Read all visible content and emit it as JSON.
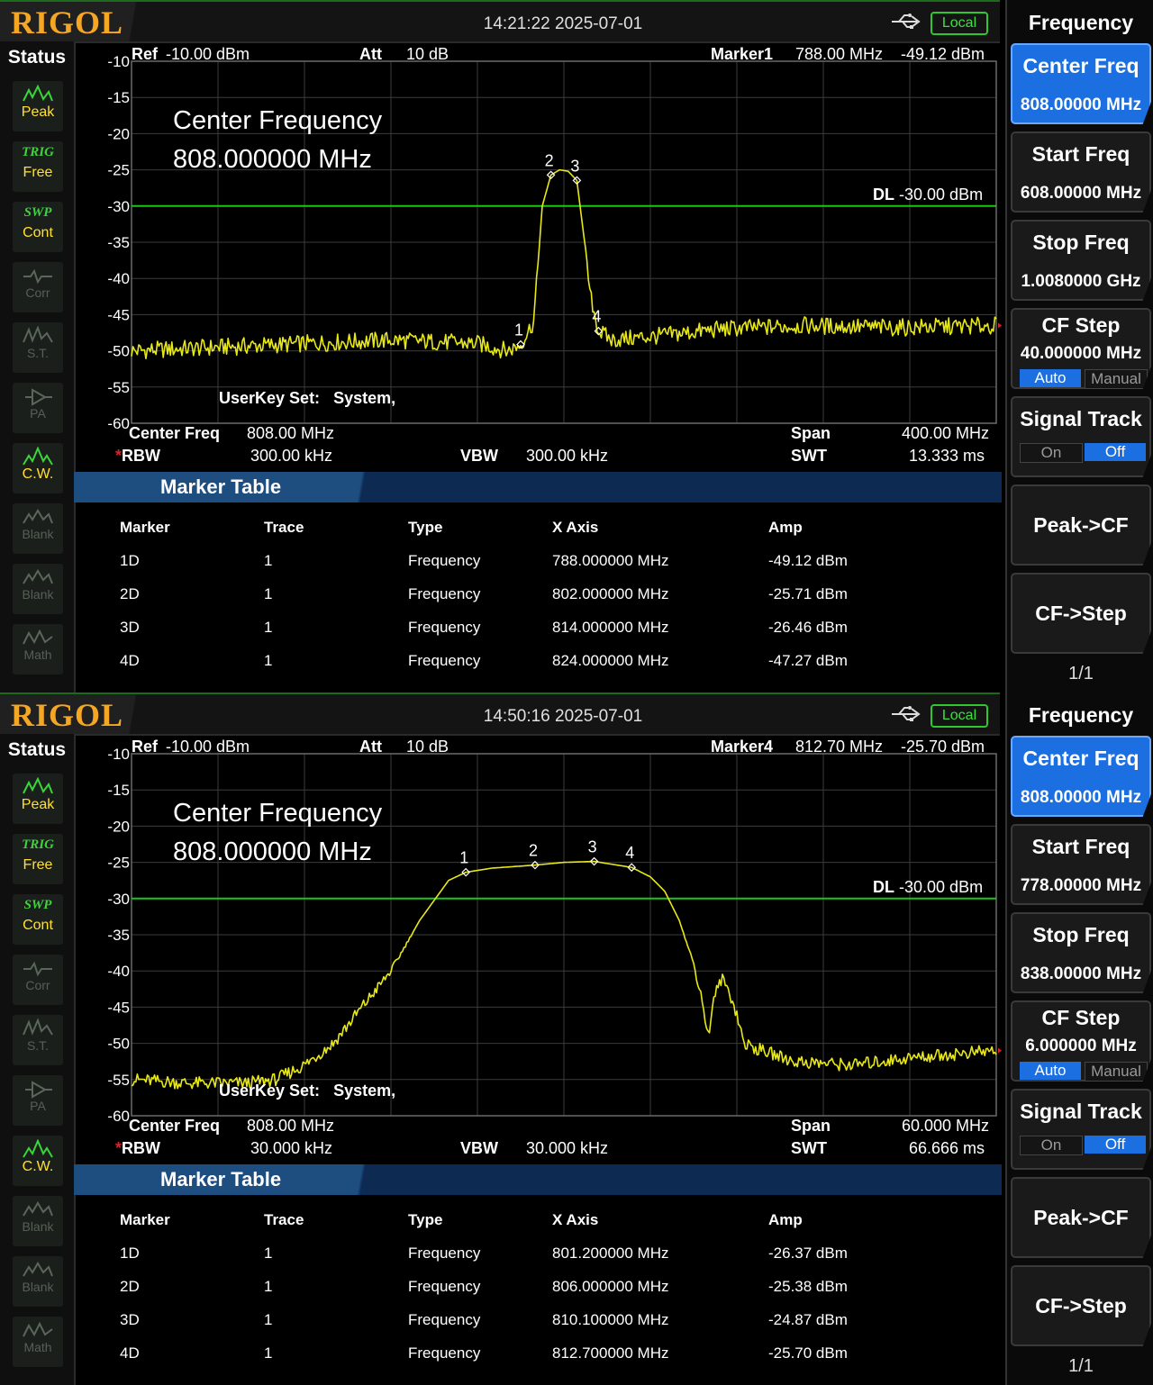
{
  "panels": [
    {
      "logo": "RIGOL",
      "datetime": "14:21:22 2025-07-01",
      "local": "Local",
      "status_title": "Status",
      "status_buttons": [
        {
          "l1": "",
          "l2": "Peak",
          "icon": "peak-icon",
          "dim": false
        },
        {
          "l1": "TRIG",
          "l2": "Free",
          "icon": "",
          "dim": false
        },
        {
          "l1": "SWP",
          "l2": "Cont",
          "icon": "",
          "dim": false
        },
        {
          "l1": "",
          "l2": "Corr",
          "icon": "corr-icon",
          "dim": true
        },
        {
          "l1": "",
          "l2": "S.T.",
          "icon": "st-icon",
          "dim": true
        },
        {
          "l1": "",
          "l2": "PA",
          "icon": "pa-icon",
          "dim": true
        },
        {
          "l1": "",
          "l2": "C.W.",
          "icon": "cw-icon",
          "dim": false
        },
        {
          "l1": "",
          "l2": "Blank",
          "icon": "blank-icon",
          "dim": true
        },
        {
          "l1": "",
          "l2": "Blank",
          "icon": "blank-icon",
          "dim": true
        },
        {
          "l1": "",
          "l2": "Math",
          "icon": "math-icon",
          "dim": true
        }
      ],
      "ref_label": "Ref",
      "ref_value": "-10.00 dBm",
      "att_label": "Att",
      "att_value": "10 dB",
      "marker_label": "Marker1",
      "marker_freq": "788.00 MHz",
      "marker_amp": "-49.12 dBm",
      "center_title": "Center Frequency",
      "center_value": "808.000000 MHz",
      "dl_label": "DL",
      "dl_value": "-30.00 dBm",
      "userkey_label": "UserKey Set:",
      "userkey_value": "System,",
      "cf_label": "Center Freq",
      "cf_value": "808.00 MHz",
      "span_label": "Span",
      "span_value": "400.00 MHz",
      "rbw_label": "RBW",
      "rbw_value": "300.00 kHz",
      "vbw_label": "VBW",
      "vbw_value": "300.00 kHz",
      "swt_label": "SWT",
      "swt_value": "13.333 ms",
      "marker_table_title": "Marker Table",
      "table_headers": [
        "Marker",
        "Trace",
        "Type",
        "X Axis",
        "Amp"
      ],
      "table_rows": [
        [
          "1D",
          "1",
          "Frequency",
          "788.000000 MHz",
          "-49.12 dBm"
        ],
        [
          "2D",
          "1",
          "Frequency",
          "802.000000 MHz",
          "-25.71 dBm"
        ],
        [
          "3D",
          "1",
          "Frequency",
          "814.000000 MHz",
          "-26.46 dBm"
        ],
        [
          "4D",
          "1",
          "Frequency",
          "824.000000 MHz",
          "-47.27 dBm"
        ]
      ],
      "menu_title": "Frequency",
      "menu": {
        "center_freq": {
          "label": "Center Freq",
          "value": "808.00000 MHz"
        },
        "start_freq": {
          "label": "Start Freq",
          "value": "608.00000 MHz"
        },
        "stop_freq": {
          "label": "Stop Freq",
          "value": "1.0080000 GHz"
        },
        "cf_step": {
          "label": "CF Step",
          "value": "40.000000 MHz",
          "auto": "Auto",
          "manual": "Manual"
        },
        "signal_track": {
          "label": "Signal Track",
          "on": "On",
          "off": "Off"
        },
        "peak_cf": "Peak->CF",
        "cf_step_btn": "CF->Step",
        "page": "1/1"
      },
      "chart_data": {
        "type": "line",
        "title": "",
        "xlabel": "",
        "ylabel": "",
        "center_mhz": 808,
        "span_mhz": 400,
        "x_range_mhz": [
          608,
          1008
        ],
        "ylim": [
          -60,
          -10
        ],
        "yticks": [
          -10,
          -15,
          -20,
          -25,
          -30,
          -35,
          -40,
          -45,
          -50,
          -55,
          -60
        ],
        "display_line_dbm": -30,
        "grid": true,
        "trace": {
          "x": [
            608,
            648,
            688,
            728,
            768,
            782,
            788,
            794,
            798,
            802,
            806,
            810,
            814,
            818,
            820,
            824,
            830,
            850,
            880,
            920,
            960,
            1008
          ],
          "y": [
            -50,
            -49.5,
            -49,
            -48.5,
            -49,
            -50,
            -49.12,
            -46,
            -30,
            -25.71,
            -25,
            -25.2,
            -26.46,
            -36,
            -42,
            -47.27,
            -48.5,
            -48,
            -47,
            -46.5,
            -46.8,
            -46.5
          ]
        },
        "markers": [
          {
            "label": "1",
            "x": 788,
            "y": -49.12
          },
          {
            "label": "2",
            "x": 802,
            "y": -25.71
          },
          {
            "label": "3",
            "x": 814,
            "y": -26.46
          },
          {
            "label": "4",
            "x": 824,
            "y": -47.27
          }
        ],
        "noise_amp_db": 1.2
      }
    },
    {
      "logo": "RIGOL",
      "datetime": "14:50:16 2025-07-01",
      "local": "Local",
      "status_title": "Status",
      "status_buttons": [
        {
          "l1": "",
          "l2": "Peak",
          "icon": "peak-icon",
          "dim": false
        },
        {
          "l1": "TRIG",
          "l2": "Free",
          "icon": "",
          "dim": false
        },
        {
          "l1": "SWP",
          "l2": "Cont",
          "icon": "",
          "dim": false
        },
        {
          "l1": "",
          "l2": "Corr",
          "icon": "corr-icon",
          "dim": true
        },
        {
          "l1": "",
          "l2": "S.T.",
          "icon": "st-icon",
          "dim": true
        },
        {
          "l1": "",
          "l2": "PA",
          "icon": "pa-icon",
          "dim": true
        },
        {
          "l1": "",
          "l2": "C.W.",
          "icon": "cw-icon",
          "dim": false
        },
        {
          "l1": "",
          "l2": "Blank",
          "icon": "blank-icon",
          "dim": true
        },
        {
          "l1": "",
          "l2": "Blank",
          "icon": "blank-icon",
          "dim": true
        },
        {
          "l1": "",
          "l2": "Math",
          "icon": "math-icon",
          "dim": true
        }
      ],
      "ref_label": "Ref",
      "ref_value": "-10.00 dBm",
      "att_label": "Att",
      "att_value": "10 dB",
      "marker_label": "Marker4",
      "marker_freq": "812.70 MHz",
      "marker_amp": "-25.70 dBm",
      "center_title": "Center Frequency",
      "center_value": "808.000000 MHz",
      "dl_label": "DL",
      "dl_value": "-30.00 dBm",
      "userkey_label": "UserKey Set:",
      "userkey_value": "System,",
      "cf_label": "Center Freq",
      "cf_value": "808.00 MHz",
      "span_label": "Span",
      "span_value": "60.000 MHz",
      "rbw_label": "RBW",
      "rbw_value": "30.000 kHz",
      "vbw_label": "VBW",
      "vbw_value": "30.000 kHz",
      "swt_label": "SWT",
      "swt_value": "66.666 ms",
      "marker_table_title": "Marker Table",
      "table_headers": [
        "Marker",
        "Trace",
        "Type",
        "X Axis",
        "Amp"
      ],
      "table_rows": [
        [
          "1D",
          "1",
          "Frequency",
          "801.200000 MHz",
          "-26.37 dBm"
        ],
        [
          "2D",
          "1",
          "Frequency",
          "806.000000 MHz",
          "-25.38 dBm"
        ],
        [
          "3D",
          "1",
          "Frequency",
          "810.100000 MHz",
          "-24.87 dBm"
        ],
        [
          "4D",
          "1",
          "Frequency",
          "812.700000 MHz",
          "-25.70 dBm"
        ]
      ],
      "menu_title": "Frequency",
      "menu": {
        "center_freq": {
          "label": "Center Freq",
          "value": "808.00000 MHz"
        },
        "start_freq": {
          "label": "Start Freq",
          "value": "778.00000 MHz"
        },
        "stop_freq": {
          "label": "Stop Freq",
          "value": "838.00000 MHz"
        },
        "cf_step": {
          "label": "CF Step",
          "value": "6.000000 MHz",
          "auto": "Auto",
          "manual": "Manual"
        },
        "signal_track": {
          "label": "Signal Track",
          "on": "On",
          "off": "Off"
        },
        "peak_cf": "Peak->CF",
        "cf_step_btn": "CF->Step",
        "page": "1/1"
      },
      "chart_data": {
        "type": "line",
        "title": "",
        "xlabel": "",
        "ylabel": "",
        "center_mhz": 808,
        "span_mhz": 60,
        "x_range_mhz": [
          778,
          838
        ],
        "ylim": [
          -60,
          -10
        ],
        "yticks": [
          -10,
          -15,
          -20,
          -25,
          -30,
          -35,
          -40,
          -45,
          -50,
          -55,
          -60
        ],
        "display_line_dbm": -30,
        "grid": true,
        "trace": {
          "x": [
            778,
            782,
            786,
            788,
            790,
            792,
            794,
            796,
            798,
            800,
            801.2,
            803,
            806,
            808,
            810.1,
            812.7,
            814,
            815,
            816,
            817,
            817.6,
            818,
            818.5,
            819,
            819.5,
            820,
            820.5,
            821,
            824,
            828,
            832,
            838
          ],
          "y": [
            -55,
            -55.5,
            -55.5,
            -55,
            -53,
            -50,
            -45,
            -40,
            -33,
            -27.5,
            -26.37,
            -25.8,
            -25.38,
            -25,
            -24.87,
            -25.7,
            -27,
            -29,
            -33,
            -39,
            -44,
            -49,
            -43,
            -41,
            -43,
            -46,
            -50,
            -50.5,
            -52.5,
            -53,
            -52,
            -51
          ]
        },
        "markers": [
          {
            "label": "1",
            "x": 801.2,
            "y": -26.37
          },
          {
            "label": "2",
            "x": 806,
            "y": -25.38
          },
          {
            "label": "3",
            "x": 810.1,
            "y": -24.87
          },
          {
            "label": "4",
            "x": 812.7,
            "y": -25.7
          }
        ],
        "noise_amp_db": 0.9
      }
    }
  ]
}
